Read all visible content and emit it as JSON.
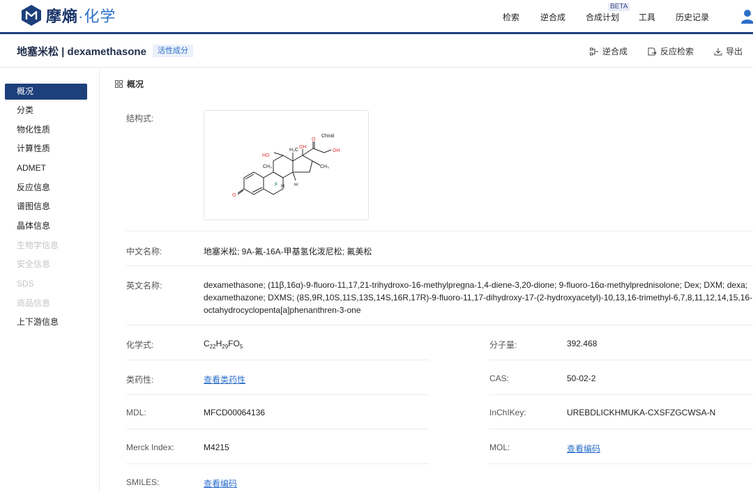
{
  "app": {
    "logo_main": "摩熵",
    "logo_sub": "·化学"
  },
  "nav": {
    "items": [
      "检索",
      "逆合成",
      "合成计划",
      "工具",
      "历史记录"
    ],
    "beta": "BETA"
  },
  "header": {
    "title": "地塞米松 | dexamethasone",
    "tag": "活性成分",
    "actions": [
      "逆合成",
      "反应检索",
      "导出"
    ]
  },
  "sidebar": {
    "items": [
      {
        "label": "概况",
        "state": "active"
      },
      {
        "label": "分类",
        "state": "normal"
      },
      {
        "label": "物化性质",
        "state": "normal"
      },
      {
        "label": "计算性质",
        "state": "normal"
      },
      {
        "label": "ADMET",
        "state": "normal"
      },
      {
        "label": "反应信息",
        "state": "normal"
      },
      {
        "label": "谱图信息",
        "state": "normal"
      },
      {
        "label": "晶体信息",
        "state": "normal"
      },
      {
        "label": "生物学信息",
        "state": "disabled"
      },
      {
        "label": "安全信息",
        "state": "disabled"
      },
      {
        "label": "SDS",
        "state": "disabled"
      },
      {
        "label": "商品信息",
        "state": "disabled"
      },
      {
        "label": "上下游信息",
        "state": "normal"
      }
    ]
  },
  "overview": {
    "section_title": "概况",
    "structure_label": "结构式:",
    "structure": {
      "chiral": "Chiral",
      "atoms": {
        "oh1": "HO",
        "oh2": "OH",
        "oh3": "OH",
        "o_keto": "O",
        "o_side": "O",
        "ch3_a": "CH₃",
        "ch3_b": "H₃C",
        "ch3_c": "CH₃",
        "f": "F",
        "h1": "H",
        "h2": "H"
      }
    },
    "cn_name_label": "中文名称:",
    "cn_name": "地塞米松; 9A-氟-16A-甲基氢化泼尼松; 氟美松",
    "en_name_label": "英文名称:",
    "en_name": "dexamethasone; (11β,16α)-9-fluoro-11,17,21-trihydroxo-16-methylpregna-1,4-diene-3,20-dione; 9-fluoro-16α-methylprednisolone; Dex; DXM; dexa; dexamethazone; DXMS; (8S,9R,10S,11S,13S,14S,16R,17R)-9-fluoro-11,17-dihydroxy-17-(2-hydroxyacetyl)-10,13,16-trimethyl-6,7,8,11,12,14,15,16-octahydrocyclopenta[a]phenanthren-3-one",
    "formula_label": "化学式:",
    "formula": {
      "c": "C",
      "c_n": "22",
      "h": "H",
      "h_n": "29",
      "rest": "FO",
      "o_n": "5"
    },
    "mw_label": "分子量:",
    "mw": "392.468",
    "druglike_label": "类药性:",
    "druglike_link": "查看类药性",
    "cas_label": "CAS:",
    "cas": "50-02-2",
    "mdl_label": "MDL:",
    "mdl": "MFCD00064136",
    "inchikey_label": "InChIKey:",
    "inchikey": "UREBDLICKHMUKA-CXSFZGCWSA-N",
    "merck_label": "Merck Index:",
    "merck": "M4215",
    "mol_label": "MOL:",
    "mol_link": "查看编码",
    "smiles_label": "SMILES:",
    "smiles_link": "查看编码"
  },
  "colors": {
    "brand": "#1d3f7a",
    "link": "#2c6fc9",
    "disabled": "#c4c4c4"
  }
}
